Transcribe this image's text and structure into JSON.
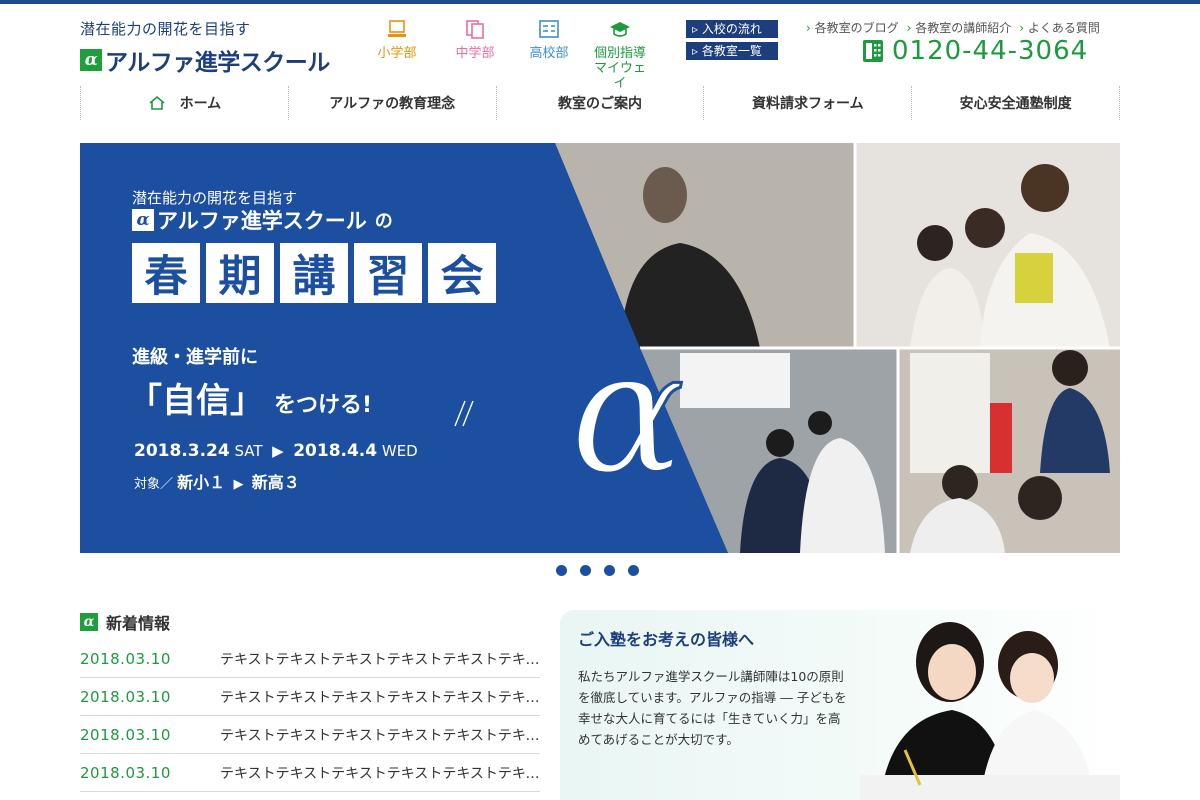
{
  "header": {
    "tagline": "潜在能力の開花を目指す",
    "school_name": "アルファ進学スクール",
    "alpha": "α",
    "departments": [
      {
        "label": "小学部",
        "color": "#e8930c"
      },
      {
        "label": "中学部",
        "color": "#ea6ea0"
      },
      {
        "label": "高校部",
        "color": "#3d8fd0"
      },
      {
        "label": "個別指導",
        "label2": "マイウェイ",
        "color": "#1d9a3e"
      }
    ],
    "quick_buttons": [
      "入校の流れ",
      "各教室一覧"
    ],
    "top_links": [
      "各教室のブログ",
      "各教室の講師紹介",
      "よくある質問"
    ],
    "phone": "0120-44-3064"
  },
  "nav": [
    "ホーム",
    "アルファの教育理念",
    "教室のご案内",
    "資料請求フォーム",
    "安心安全通塾制度"
  ],
  "hero": {
    "tagline": "潜在能力の開花を目指す",
    "school": "アルファ進学スクール",
    "particle": "の",
    "title_chars": [
      "春",
      "期",
      "講",
      "習",
      "会"
    ],
    "sub": "進級・進学前に",
    "big": "「自信」",
    "big_tail": "をつける!",
    "date_start": "2018.3.24",
    "date_start_day": "SAT",
    "date_end": "2018.4.4",
    "date_end_day": "WED",
    "target_label": "対象／",
    "target_from": "新小１",
    "target_to": "新高３"
  },
  "news": {
    "title": "新着情報",
    "items": [
      {
        "date": "2018.03.10",
        "text": "テキストテキストテキストテキストテキストテキスト"
      },
      {
        "date": "2018.03.10",
        "text": "テキストテキストテキストテキストテキストテキスト"
      },
      {
        "date": "2018.03.10",
        "text": "テキストテキストテキストテキストテキストテキスト"
      },
      {
        "date": "2018.03.10",
        "text": "テキストテキストテキストテキストテキストテキスト"
      }
    ]
  },
  "welcome": {
    "title": "ご入塾をお考えの皆様へ",
    "body": "私たちアルファ進学スクール講師陣は10の原則を徹底しています。アルファの指導 ― 子どもを幸せな大人に育てるには「生きていく力」を高めてあげることが大切です。"
  },
  "colors": {
    "brand_blue": "#1d4fa0",
    "brand_green": "#1d9a3e"
  }
}
